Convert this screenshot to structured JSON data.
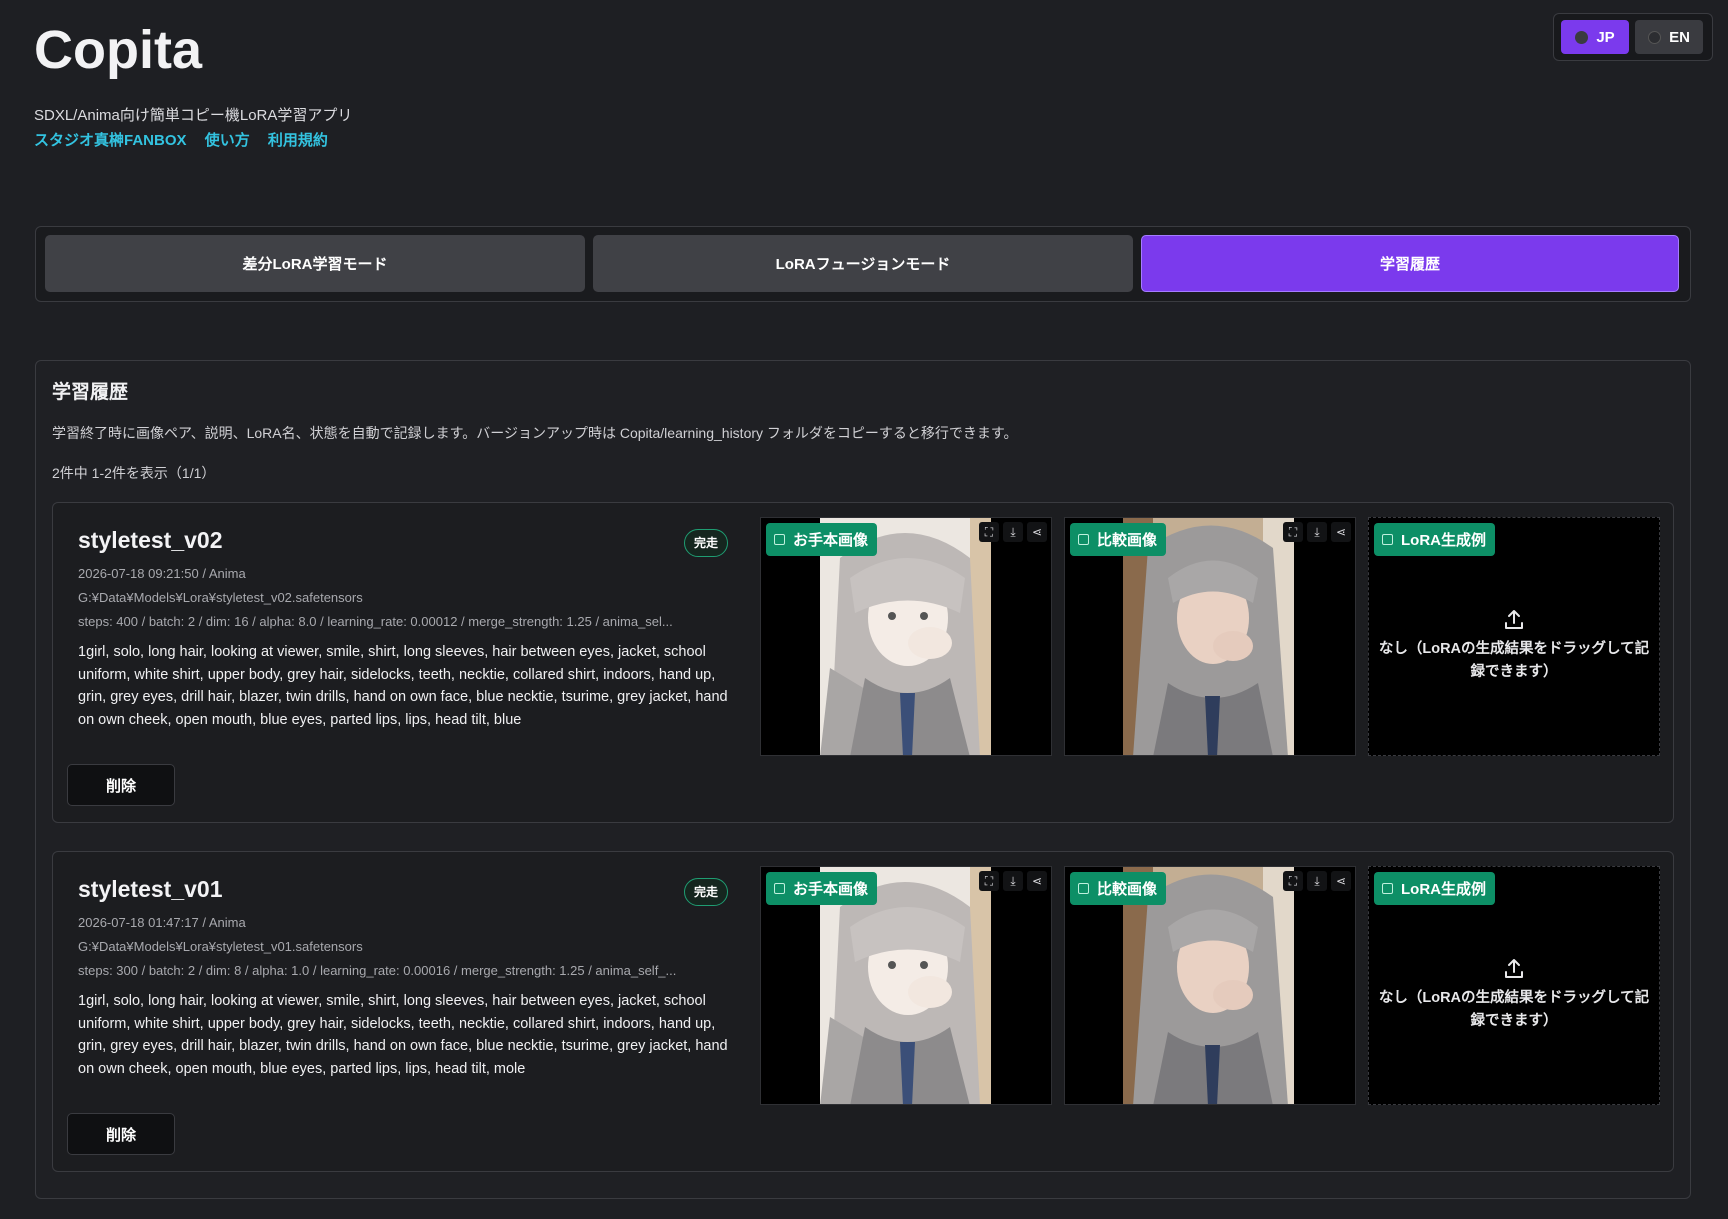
{
  "app": {
    "title": "Copita",
    "subtitle": "SDXL/Anima向け簡単コピー機LoRA学習アプリ",
    "links": [
      "スタジオ真榊FANBOX",
      "使い方",
      "利用規約"
    ]
  },
  "lang": {
    "jp": "JP",
    "en": "EN",
    "selected": "JP"
  },
  "modes": {
    "diff": "差分LoRA学習モード",
    "fusion": "LoRAフュージョンモード",
    "history": "学習履歴",
    "selected": "学習履歴"
  },
  "history": {
    "title": "学習履歴",
    "description": "学習終了時に画像ペア、説明、LoRA名、状態を自動で記録します。バージョンアップ時は Copita/learning_history フォルダをコピーすると移行できます。",
    "count": "2件中 1-2件を表示（1/1）",
    "slot_labels": {
      "sample": "お手本画像",
      "compare": "比較画像",
      "lora": "LoRA生成例"
    },
    "empty_text": "なし（LoRAの生成結果をドラッグして記録できます）",
    "delete_label": "削除",
    "items": [
      {
        "name": "styletest_v02",
        "status": "完走",
        "datetime": "2026-07-18 09:21:50 / Anima",
        "path": "G:¥Data¥Models¥Lora¥styletest_v02.safetensors",
        "params": "steps: 400 / batch: 2 / dim: 16 / alpha: 8.0 / learning_rate: 0.00012 / merge_strength: 1.25 / anima_sel...",
        "tags": "1girl, solo, long hair, looking at viewer, smile, shirt, long sleeves, hair between eyes, jacket, school uniform, white shirt, upper body, grey hair, sidelocks, teeth, necktie, collared shirt, indoors, hand up, grin, grey eyes, drill hair, blazer, twin drills, hand on own face, blue necktie, tsurime, grey jacket, hand on own cheek, open mouth, blue eyes, parted lips, lips, head tilt, blue"
      },
      {
        "name": "styletest_v01",
        "status": "完走",
        "datetime": "2026-07-18 01:47:17 / Anima",
        "path": "G:¥Data¥Models¥Lora¥styletest_v01.safetensors",
        "params": "steps: 300 / batch: 2 / dim: 8 / alpha: 1.0 / learning_rate: 0.00016 / merge_strength: 1.25 / anima_self_...",
        "tags": "1girl, solo, long hair, looking at viewer, smile, shirt, long sleeves, hair between eyes, jacket, school uniform, white shirt, upper body, grey hair, sidelocks, teeth, necktie, collared shirt, indoors, hand up, grin, grey eyes, drill hair, blazer, twin drills, hand on own face, blue necktie, tsurime, grey jacket, hand on own cheek, open mouth, blue eyes, parted lips, lips, head tilt, mole"
      }
    ]
  },
  "colors": {
    "accent": "#7b3aed",
    "badge": "#0d8f66",
    "link": "#33c3e0",
    "background": "#1e1f23"
  }
}
